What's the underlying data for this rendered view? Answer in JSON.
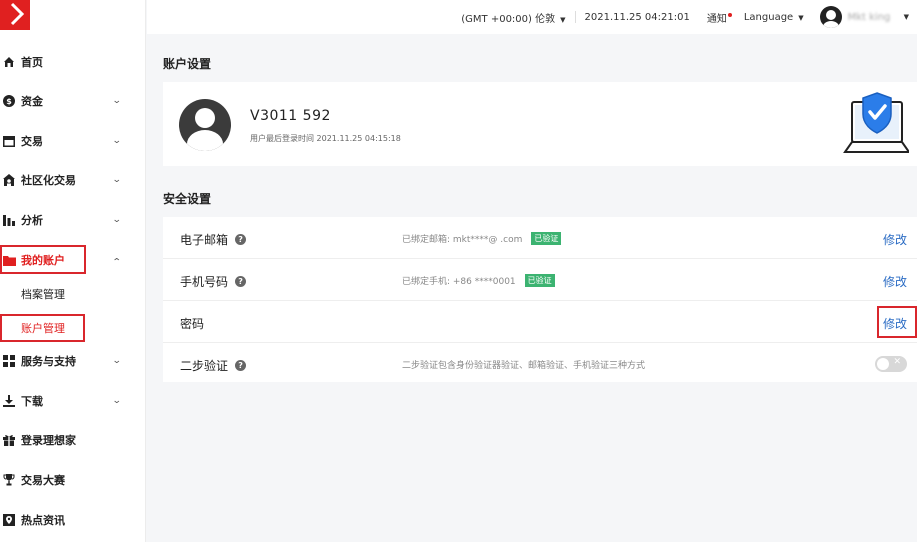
{
  "topbar": {
    "timezone": "(GMT +00:00) 伦敦",
    "datetime": "2021.11.25 04:21:01",
    "notice": "通知",
    "language": "Language",
    "username": "Mkt king"
  },
  "sidebar": {
    "items": [
      {
        "label": "首页",
        "icon": "home-icon"
      },
      {
        "label": "资金",
        "icon": "dollar-icon"
      },
      {
        "label": "交易",
        "icon": "card-icon"
      },
      {
        "label": "社区化交易",
        "icon": "community-icon"
      },
      {
        "label": "分析",
        "icon": "bar-chart-icon"
      },
      {
        "label": "我的账户",
        "icon": "folder-icon"
      },
      {
        "label": "服务与支持",
        "icon": "grid-icon"
      },
      {
        "label": "下载",
        "icon": "download-icon"
      },
      {
        "label": "登录理想家",
        "icon": "gift-icon"
      },
      {
        "label": "交易大赛",
        "icon": "trophy-icon"
      },
      {
        "label": "热点资讯",
        "icon": "news-icon"
      }
    ],
    "sub_items": [
      {
        "label": "档案管理"
      },
      {
        "label": "账户管理"
      }
    ]
  },
  "account": {
    "section_title": "账户设置",
    "id": "V3011 592",
    "last_login": "用户最后登录时间 2021.11.25 04:15:18"
  },
  "security": {
    "section_title": "安全设置",
    "rows": [
      {
        "label": "电子邮箱",
        "info": "已绑定邮箱: mkt****@ .com",
        "badge": "已验证",
        "action": "修改"
      },
      {
        "label": "手机号码",
        "info": "已绑定手机: +86 ****0001",
        "badge": "已验证",
        "action": "修改"
      },
      {
        "label": "密码",
        "info": "",
        "badge": "",
        "action": "修改"
      },
      {
        "label": "二步验证",
        "info": "二步验证包含身份验证器验证、邮箱验证、手机验证三种方式",
        "badge": "",
        "action": ""
      }
    ]
  },
  "colors": {
    "accent_red": "#e02020",
    "link_blue": "#2b6cc4",
    "verified_green": "#3cb371"
  }
}
